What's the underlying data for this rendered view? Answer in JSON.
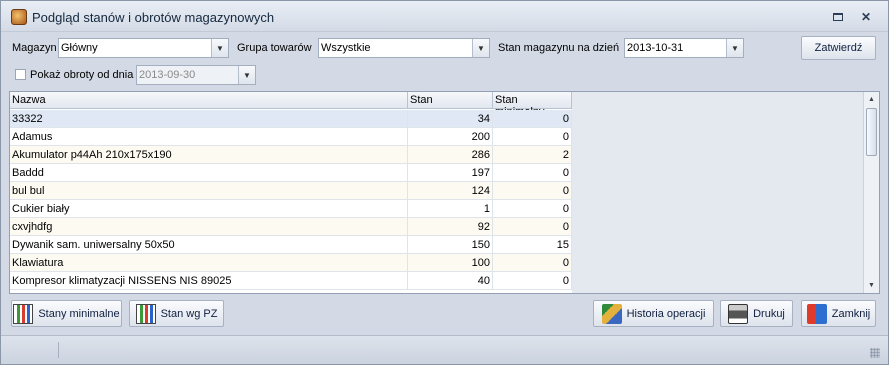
{
  "window": {
    "title": "Podgląd stanów i obrotów magazynowych"
  },
  "filters": {
    "magazyn_label": "Magazyn",
    "magazyn_value": "Główny",
    "grupa_label": "Grupa towarów",
    "grupa_value": "Wszystkie",
    "stan_label": "Stan magazynu na dzień",
    "stan_value": "2013-10-31",
    "confirm_label": "Zatwierdź",
    "obroty_label": "Pokaż obroty od dnia",
    "obroty_value": "2013-09-30"
  },
  "grid": {
    "columns": [
      "Nazwa",
      "Stan",
      "Stan minimalny"
    ],
    "rows": [
      [
        "33322",
        "34",
        "0"
      ],
      [
        "Adamus",
        "200",
        "0"
      ],
      [
        "Akumulator p44Ah 210x175x190",
        "286",
        "2"
      ],
      [
        "Baddd",
        "197",
        "0"
      ],
      [
        "bul bul",
        "124",
        "0"
      ],
      [
        "Cukier biały",
        "1",
        "0"
      ],
      [
        "cxvjhdfg",
        "92",
        "0"
      ],
      [
        "Dywanik sam. uniwersalny 50x50",
        "150",
        "15"
      ],
      [
        "Klawiatura",
        "100",
        "0"
      ],
      [
        "Kompresor klimatyzacji NISSENS NIS 89025",
        "40",
        "0"
      ]
    ]
  },
  "buttons": {
    "stany_minimalne": "Stany minimalne",
    "stan_wg_pz": "Stan wg PZ",
    "historia": "Historia operacji",
    "drukuj": "Drukuj",
    "zamknij": "Zamknij"
  },
  "icons": {
    "app": "warehouse-icon",
    "chart": "bar-chart-icon",
    "books": "books-icon",
    "printer": "printer-icon",
    "exit": "exit-door-icon"
  }
}
